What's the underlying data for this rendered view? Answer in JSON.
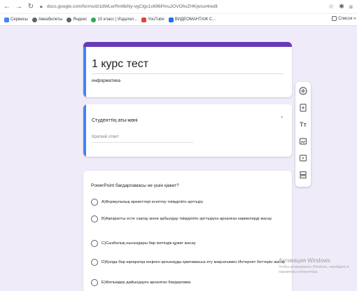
{
  "browser": {
    "url": "docs.google.com/forms/d/1dWLerRm6bNy-vgCIgc1x696PmuJOVOhvZHKjwssI4/edit",
    "bookmarks": [
      {
        "label": "Сервисы",
        "color": "#4285f4"
      },
      {
        "label": "Авиабилеты",
        "color": "#5f6368"
      },
      {
        "label": "Яндекс",
        "color": "#5f6368"
      },
      {
        "label": "10 класс | Издател...",
        "color": "#34a853"
      },
      {
        "label": "YouTube",
        "color": "#ea4335"
      },
      {
        "label": "ВИДЕОМАНТАЖ С...",
        "color": "#1a73e8"
      }
    ],
    "reading_list": "Список ч"
  },
  "form": {
    "title": "1 курс тест",
    "description": "информатика",
    "q1": {
      "title": "Студенттің аты-жөні",
      "required": "*",
      "placeholder": "Краткий ответ"
    },
    "q2": {
      "title": "PowerPoint бағдарламасы не үшін қажет?",
      "options": [
        "А)Формулалық әрекеттері есептеу тиімділігін арттыру",
        "В)Ақпаратты есте сақтау және қабылдау тиімділігін арттыруға арналған көрмелерді жасау",
        "С)Сызбалық нысандары бар мәтіндік құжат жасау",
        "D)Қолда бар ақпаратқа кеңінен қатынауды қамтамасыз ету мақсатымен Интернет беттерін жасау",
        "Е)Фильмдер дайындауға арналған бағдарлама"
      ]
    }
  },
  "toolbar": {
    "icons": [
      "add-circle-icon",
      "import-icon",
      "title-icon",
      "image-icon",
      "video-icon",
      "section-icon"
    ]
  },
  "watermark": {
    "title": "Активация Windows",
    "subtitle": "Чтобы активировать Windows, перейдите в параметры компьютера."
  },
  "colors": {
    "accent": "#673ab7",
    "background": "#f0ebf8",
    "focus": "#4285f4"
  }
}
